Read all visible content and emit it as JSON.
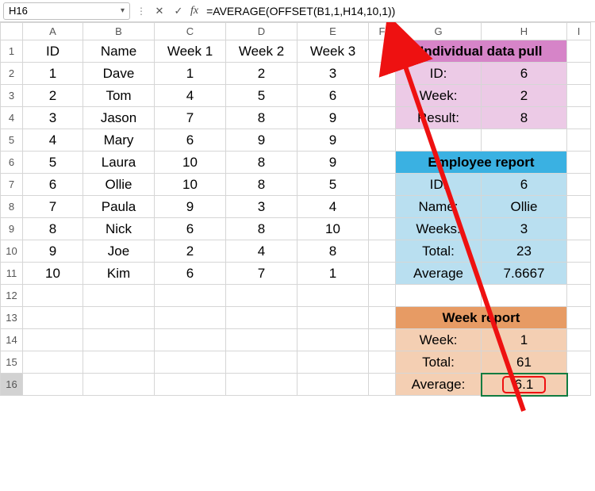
{
  "formula_bar": {
    "name_box": "H16",
    "formula": "=AVERAGE(OFFSET(B1,1,H14,10,1))"
  },
  "columns": [
    "A",
    "B",
    "C",
    "D",
    "E",
    "F",
    "G",
    "H",
    "I"
  ],
  "header": {
    "A": "ID",
    "B": "Name",
    "C": "Week 1",
    "D": "Week 2",
    "E": "Week 3"
  },
  "rows": [
    {
      "id": "1",
      "name": "Dave",
      "w1": "1",
      "w2": "2",
      "w3": "3"
    },
    {
      "id": "2",
      "name": "Tom",
      "w1": "4",
      "w2": "5",
      "w3": "6"
    },
    {
      "id": "3",
      "name": "Jason",
      "w1": "7",
      "w2": "8",
      "w3": "9"
    },
    {
      "id": "4",
      "name": "Mary",
      "w1": "6",
      "w2": "9",
      "w3": "9"
    },
    {
      "id": "5",
      "name": "Laura",
      "w1": "10",
      "w2": "8",
      "w3": "9"
    },
    {
      "id": "6",
      "name": "Ollie",
      "w1": "10",
      "w2": "8",
      "w3": "5"
    },
    {
      "id": "7",
      "name": "Paula",
      "w1": "9",
      "w2": "3",
      "w3": "4"
    },
    {
      "id": "8",
      "name": "Nick",
      "w1": "6",
      "w2": "8",
      "w3": "10"
    },
    {
      "id": "9",
      "name": "Joe",
      "w1": "2",
      "w2": "4",
      "w3": "8"
    },
    {
      "id": "10",
      "name": "Kim",
      "w1": "6",
      "w2": "7",
      "w3": "1"
    }
  ],
  "individual": {
    "title": "Individual data pull",
    "id_label": "ID:",
    "id_val": "6",
    "week_label": "Week:",
    "week_val": "2",
    "result_label": "Result:",
    "result_val": "8"
  },
  "employee": {
    "title": "Employee report",
    "id_label": "ID:",
    "id_val": "6",
    "name_label": "Name:",
    "name_val": "Ollie",
    "weeks_label": "Weeks:",
    "weeks_val": "3",
    "total_label": "Total:",
    "total_val": "23",
    "avg_label": "Average",
    "avg_val": "7.6667"
  },
  "week": {
    "title": "Week report",
    "week_label": "Week:",
    "week_val": "1",
    "total_label": "Total:",
    "total_val": "61",
    "avg_label": "Average:",
    "avg_val": "6.1"
  },
  "selected_row": "16"
}
